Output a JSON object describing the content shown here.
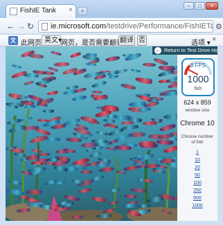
{
  "tab": {
    "title": "FishIE Tank",
    "close": "×",
    "new_tab": "+"
  },
  "window_controls": {
    "minimize": "–",
    "maximize": "□",
    "close": "×"
  },
  "toolbar": {
    "back": "←",
    "forward": "→",
    "reload": "↻",
    "url_host": "ie.microsoft.com",
    "url_path": "/testdrive/Performance/FishIETank/Default.ht",
    "wrench": "⚙"
  },
  "translate_bar": {
    "icon": "文",
    "prefix": "此网页为",
    "language": "英文",
    "question": "网页，是否需要翻译？",
    "translate_button": "翻译",
    "no_button": "否",
    "options": "选项",
    "close": "×"
  },
  "page": {
    "return_icon": "←",
    "return_link": "Return to Test Drive Home",
    "fps_label": "8 FPS",
    "fish_count": "1000",
    "fish_unit": "fish",
    "window_size": "624 x 859",
    "window_size_label": "window size",
    "browser_name": "Chrome 10",
    "choose_label_line1": "Choose number",
    "choose_label_line2": "of fish",
    "fish_options": [
      "1",
      "10",
      "20",
      "50",
      "100",
      "250",
      "500",
      "1000"
    ]
  },
  "colors": {
    "accent_blue": "#1c88c9",
    "gauge_red": "#d9322a",
    "water_top": "#7ec4d3",
    "water_bottom": "#2b5e66"
  }
}
